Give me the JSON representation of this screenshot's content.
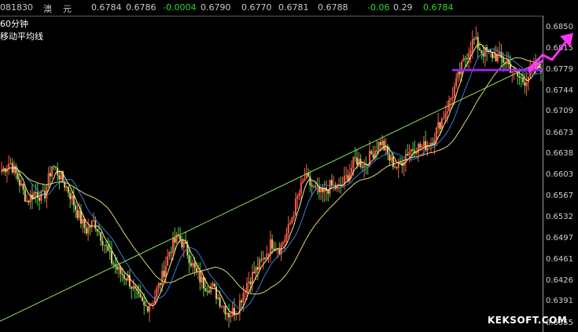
{
  "quote_bar": {
    "code": "081830",
    "name_part1": "澳",
    "name_part2": "元",
    "v1": "0.6784",
    "v2": "0.6786",
    "change": "-0.0004",
    "v3": "0.6790",
    "v4": "0.6770",
    "v5": "0.6781",
    "v6": "0.6788",
    "change_pct": "-0.06",
    "v7": "0.29",
    "last": "0.6784"
  },
  "labels": {
    "period": "60分钟",
    "indicator": "移动平均线",
    "watermark": "KEKSOFT.COM"
  },
  "colors": {
    "background": "#000000",
    "candle": "#e8c46a",
    "ma_fast": "#f2f2a0",
    "ma_mid": "#3a7bd5",
    "ma_slow": "#d8d870",
    "trendline": "#8ee05a",
    "resistance": "#a020f0",
    "arrow": "#ff33ff",
    "up_text": "#2fd62f"
  },
  "chart_data": {
    "type": "candlestick",
    "ylim": [
      0.634,
      0.687
    ],
    "y_ticks": [
      "0.6850",
      "0.6815",
      "0.6779",
      "0.6744",
      "0.6709",
      "0.6673",
      "0.6638",
      "0.6603",
      "0.6567",
      "0.6532",
      "0.6497",
      "0.6461",
      "0.6426",
      "0.6391",
      "0.6355"
    ],
    "close_path": [
      0.661,
      0.6625,
      0.6595,
      0.656,
      0.6575,
      0.6565,
      0.662,
      0.66,
      0.6575,
      0.654,
      0.651,
      0.6525,
      0.6495,
      0.646,
      0.644,
      0.643,
      0.64,
      0.638,
      0.6395,
      0.643,
      0.648,
      0.65,
      0.6475,
      0.644,
      0.642,
      0.6415,
      0.639,
      0.637,
      0.638,
      0.642,
      0.644,
      0.646,
      0.649,
      0.648,
      0.651,
      0.656,
      0.66,
      0.658,
      0.657,
      0.6585,
      0.658,
      0.66,
      0.663,
      0.662,
      0.664,
      0.666,
      0.663,
      0.6615,
      0.664,
      0.665,
      0.665,
      0.666,
      0.669,
      0.672,
      0.676,
      0.68,
      0.683,
      0.681,
      0.6805,
      0.68,
      0.679,
      0.677,
      0.676,
      0.678,
      0.6784
    ],
    "trendline": {
      "from": 0.6358,
      "to": 0.6795
    },
    "resistance_level": 0.6779
  }
}
